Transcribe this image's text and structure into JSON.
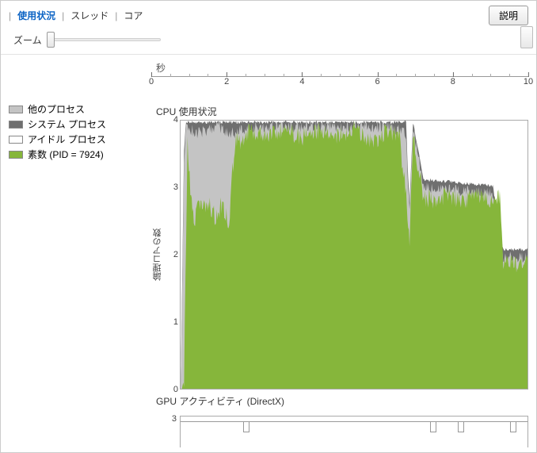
{
  "tabs": {
    "usage": "使用状況",
    "threads": "スレッド",
    "cores": "コア"
  },
  "help_button": "説明",
  "zoom_label": "ズーム",
  "x_axis_label": "秒",
  "legend": {
    "other": {
      "label": "他のプロセス",
      "color": "#c4c4c4"
    },
    "system": {
      "label": "システム プロセス",
      "color": "#6f6f6f"
    },
    "idle": {
      "label": "アイドル プロセス",
      "color": "#ffffff"
    },
    "app": {
      "label": "素数 (PID = 7924)",
      "color": "#86b63b"
    }
  },
  "chart1": {
    "title": "CPU 使用状況",
    "ylabel": "論理コアの数",
    "ylim": [
      0,
      4
    ],
    "yticks": [
      0,
      1,
      2,
      3,
      4
    ]
  },
  "chart2": {
    "title": "GPU アクティビティ (DirectX)",
    "ytick_top": 3,
    "dips_x_pct": [
      18,
      72,
      80,
      95
    ]
  },
  "x_axis": {
    "range": [
      0,
      10
    ],
    "major": [
      0,
      2,
      4,
      6,
      8,
      10
    ]
  },
  "chart_data": {
    "type": "area",
    "xlabel": "秒",
    "ylabel": "論理コアの数",
    "xlim": [
      0,
      10
    ],
    "ylim": [
      0,
      4
    ],
    "title": "CPU 使用状況",
    "series": [
      {
        "name": "素数 (PID = 7924)",
        "color": "#86b63b",
        "points": [
          {
            "x": 0.0,
            "y": 0.0
          },
          {
            "x": 0.1,
            "y": 0.3
          },
          {
            "x": 0.2,
            "y": 3.8
          },
          {
            "x": 0.3,
            "y": 3.0
          },
          {
            "x": 0.4,
            "y": 2.5
          },
          {
            "x": 0.5,
            "y": 3.0
          },
          {
            "x": 0.6,
            "y": 2.8
          },
          {
            "x": 0.8,
            "y": 2.9
          },
          {
            "x": 1.0,
            "y": 2.7
          },
          {
            "x": 1.2,
            "y": 2.9
          },
          {
            "x": 1.4,
            "y": 2.6
          },
          {
            "x": 1.5,
            "y": 3.4
          },
          {
            "x": 1.6,
            "y": 3.9
          },
          {
            "x": 1.8,
            "y": 3.8
          },
          {
            "x": 2.0,
            "y": 4.0
          },
          {
            "x": 2.5,
            "y": 3.9
          },
          {
            "x": 3.0,
            "y": 4.0
          },
          {
            "x": 3.5,
            "y": 3.9
          },
          {
            "x": 4.0,
            "y": 4.0
          },
          {
            "x": 4.5,
            "y": 3.9
          },
          {
            "x": 5.0,
            "y": 4.0
          },
          {
            "x": 5.5,
            "y": 3.8
          },
          {
            "x": 6.0,
            "y": 4.0
          },
          {
            "x": 6.3,
            "y": 3.9
          },
          {
            "x": 6.5,
            "y": 3.0
          },
          {
            "x": 6.6,
            "y": 2.4
          },
          {
            "x": 6.7,
            "y": 3.9
          },
          {
            "x": 7.0,
            "y": 3.0
          },
          {
            "x": 7.3,
            "y": 2.95
          },
          {
            "x": 7.6,
            "y": 3.0
          },
          {
            "x": 8.0,
            "y": 2.95
          },
          {
            "x": 8.5,
            "y": 3.0
          },
          {
            "x": 9.0,
            "y": 2.95
          },
          {
            "x": 9.2,
            "y": 3.0
          },
          {
            "x": 9.3,
            "y": 2.0
          },
          {
            "x": 9.6,
            "y": 2.0
          },
          {
            "x": 10.0,
            "y": 2.0
          }
        ]
      },
      {
        "name": "他のプロセス",
        "color": "#c4c4c4",
        "points": [
          {
            "x": 0.0,
            "y": 0.0
          },
          {
            "x": 0.1,
            "y": 3.5
          },
          {
            "x": 0.15,
            "y": 4.0
          },
          {
            "x": 0.5,
            "y": 3.9
          },
          {
            "x": 1.0,
            "y": 4.0
          },
          {
            "x": 1.5,
            "y": 3.9
          },
          {
            "x": 2.0,
            "y": 4.0
          },
          {
            "x": 3.0,
            "y": 4.0
          },
          {
            "x": 4.0,
            "y": 4.0
          },
          {
            "x": 5.0,
            "y": 4.0
          },
          {
            "x": 6.0,
            "y": 4.0
          },
          {
            "x": 6.5,
            "y": 3.9
          },
          {
            "x": 6.55,
            "y": 3.2
          },
          {
            "x": 6.6,
            "y": 2.7
          },
          {
            "x": 6.7,
            "y": 4.0
          },
          {
            "x": 7.0,
            "y": 3.1
          },
          {
            "x": 7.3,
            "y": 3.05
          },
          {
            "x": 8.0,
            "y": 3.05
          },
          {
            "x": 9.0,
            "y": 3.0
          },
          {
            "x": 9.3,
            "y": 2.05
          },
          {
            "x": 10.0,
            "y": 2.05
          }
        ]
      },
      {
        "name": "システム プロセス",
        "color": "#6f6f6f",
        "points": [
          {
            "x": 0.0,
            "y": 0.0
          },
          {
            "x": 0.1,
            "y": 3.6
          },
          {
            "x": 0.15,
            "y": 4.0
          },
          {
            "x": 1.0,
            "y": 4.0
          },
          {
            "x": 2.0,
            "y": 4.0
          },
          {
            "x": 4.0,
            "y": 4.0
          },
          {
            "x": 6.0,
            "y": 4.0
          },
          {
            "x": 6.5,
            "y": 4.0
          },
          {
            "x": 6.55,
            "y": 3.3
          },
          {
            "x": 6.6,
            "y": 2.8
          },
          {
            "x": 6.7,
            "y": 4.0
          },
          {
            "x": 7.0,
            "y": 3.15
          },
          {
            "x": 8.0,
            "y": 3.1
          },
          {
            "x": 9.0,
            "y": 3.05
          },
          {
            "x": 9.3,
            "y": 2.1
          },
          {
            "x": 10.0,
            "y": 2.1
          }
        ]
      }
    ]
  }
}
